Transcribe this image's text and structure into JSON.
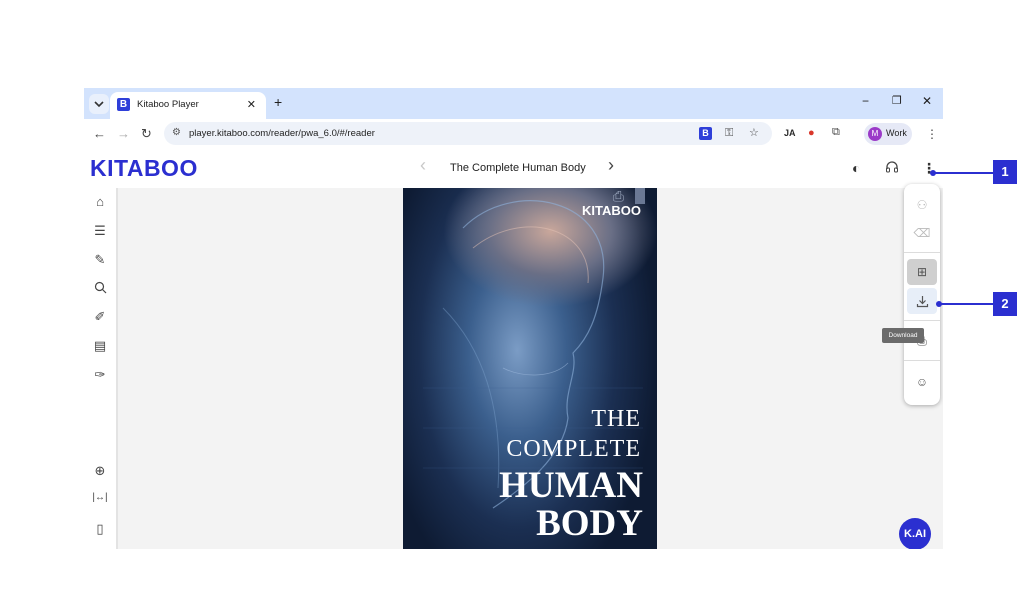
{
  "browser": {
    "tab_title": "Kitaboo Player",
    "tab_close": "✕",
    "new_tab": "+",
    "favicon_letter": "B",
    "window_controls": {
      "minimize": "−",
      "restore": "❐",
      "close": "✕"
    },
    "url": "player.kitaboo.com/reader/pwa_6.0/#/reader",
    "extension_b": "B",
    "extension_ja": "JA",
    "profile_initial": "M",
    "profile_name": "Work"
  },
  "app": {
    "logo": "KITABOO",
    "book_title": "The Complete Human Body",
    "prev_glyph": "‹",
    "next_glyph": "›"
  },
  "cover": {
    "brand": "KITABOO",
    "line1": "THE",
    "line2": "COMPLETE",
    "line3": "HUMAN",
    "line4": "BODY"
  },
  "tooltip": "Download",
  "kai_label": "K.AI",
  "annotations": [
    "1",
    "2"
  ],
  "colors": {
    "brand": "#2b2fd0",
    "tabstrip": "#d3e3fd"
  },
  "icons": {
    "sidebar": [
      "home-icon",
      "table-of-contents-icon",
      "notes-icon",
      "search-icon",
      "pen-icon",
      "sticky-note-icon",
      "highlighter-icon",
      "zoom-in-icon",
      "fit-width-icon",
      "page-icon"
    ],
    "panel": [
      "share-icon",
      "eraser-icon",
      "add-folder-icon",
      "download-icon",
      "print-icon",
      "profile-icon"
    ]
  }
}
